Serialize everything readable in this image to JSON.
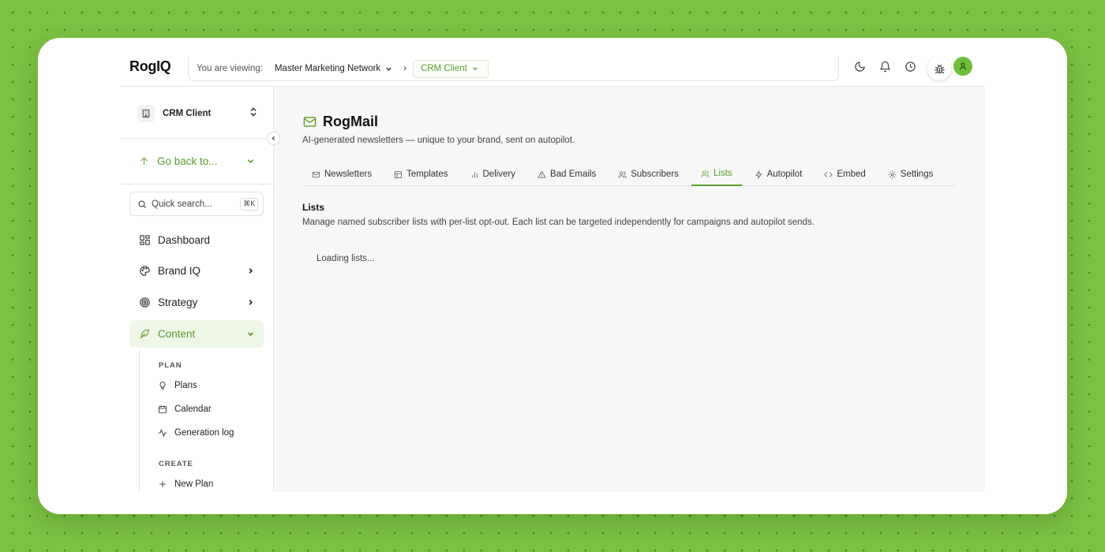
{
  "brand": {
    "logo": "RogIQ",
    "accent": "#5a9c2a"
  },
  "topbar": {
    "viewing_label": "You are viewing:",
    "network": "Master Marketing Network",
    "separator": "›",
    "client": "CRM Client",
    "icons": [
      "moon-icon",
      "bell-icon",
      "clock-icon",
      "bug-icon",
      "user-icon"
    ]
  },
  "sidebar": {
    "client_name": "CRM Client",
    "go_back": "Go back to...",
    "search_placeholder": "Quick search...",
    "search_shortcut": "⌘K",
    "nav": [
      {
        "label": "Dashboard",
        "icon": "dashboard-icon"
      },
      {
        "label": "Brand IQ",
        "icon": "palette-icon"
      },
      {
        "label": "Strategy",
        "icon": "target-icon"
      },
      {
        "label": "Content",
        "icon": "feather-icon",
        "active": true
      }
    ],
    "content_sub": {
      "plan_heading": "PLAN",
      "plan_items": [
        "Plans",
        "Calendar",
        "Generation log"
      ],
      "create_heading": "CREATE",
      "create_items": [
        "New Plan"
      ]
    }
  },
  "main": {
    "title": "RogMail",
    "subtitle": "AI-generated newsletters — unique to your brand, sent on autopilot.",
    "tabs": [
      {
        "label": "Newsletters",
        "icon": "mail-icon"
      },
      {
        "label": "Templates",
        "icon": "template-icon"
      },
      {
        "label": "Delivery",
        "icon": "bar-chart-icon"
      },
      {
        "label": "Bad Emails",
        "icon": "warning-icon"
      },
      {
        "label": "Subscribers",
        "icon": "users-icon"
      },
      {
        "label": "Lists",
        "icon": "users-icon",
        "active": true
      },
      {
        "label": "Autopilot",
        "icon": "zap-icon"
      },
      {
        "label": "Embed",
        "icon": "code-icon"
      },
      {
        "label": "Settings",
        "icon": "gear-icon"
      }
    ],
    "section_title": "Lists",
    "section_desc": "Manage named subscriber lists with per-list opt-out. Each list can be targeted independently for campaigns and autopilot sends.",
    "loading_text": "Loading lists..."
  }
}
